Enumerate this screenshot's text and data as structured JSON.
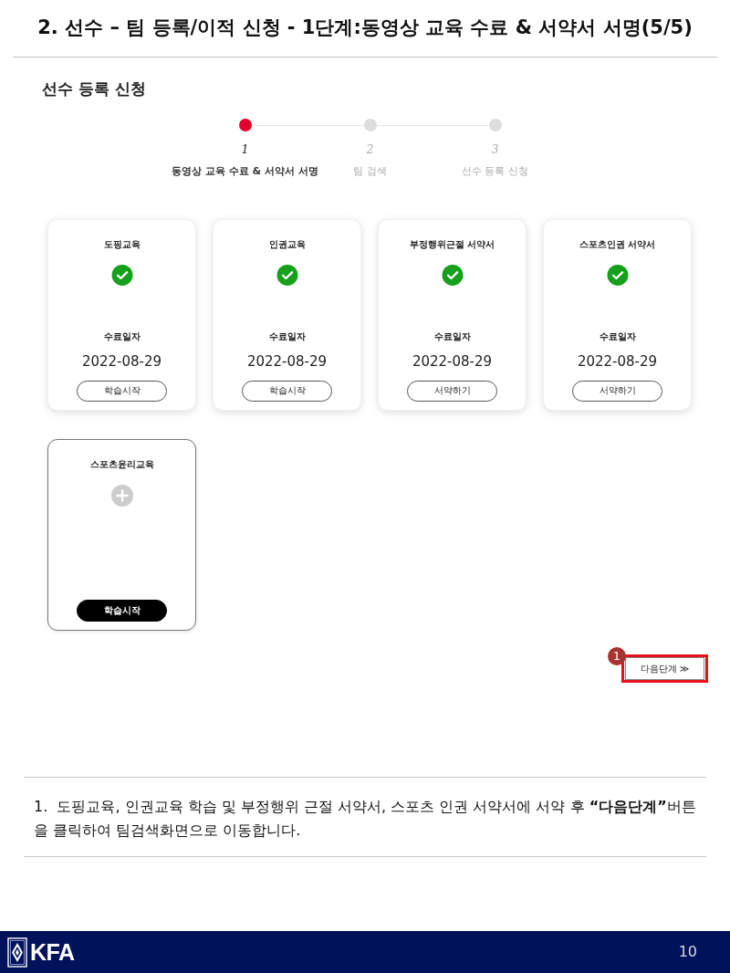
{
  "title": "2. 선수 – 팀 등록/이적 신청 - 1단계:동영상 교육 수료 & 서약서 서명(5/5)",
  "section_title": "선수 등록 신청",
  "steps": [
    {
      "number": "1",
      "label": "동영상 교육 수료 & 서약서 서명",
      "selected": true
    },
    {
      "number": "2",
      "label": "팀 검색",
      "selected": false
    },
    {
      "number": "3",
      "label": "선수 등록 신청",
      "selected": false
    }
  ],
  "cards": [
    {
      "title": "도핑교육",
      "completed": true,
      "date_label": "수료일자",
      "date": "2022-08-29",
      "button": "학습시작"
    },
    {
      "title": "인권교육",
      "completed": true,
      "date_label": "수료일자",
      "date": "2022-08-29",
      "button": "학습시작"
    },
    {
      "title": "부정행위근절 서약서",
      "completed": true,
      "date_label": "수료일자",
      "date": "2022-08-29",
      "button": "서약하기"
    },
    {
      "title": "스포츠인권 서약서",
      "completed": true,
      "date_label": "수료일자",
      "date": "2022-08-29",
      "button": "서약하기"
    },
    {
      "title": "스포츠윤리교육",
      "completed": false,
      "button": "학습시작"
    }
  ],
  "next_button": {
    "label": "다음단계 ≫",
    "highlighted": true,
    "callout": "1"
  },
  "note": "1.  도핑교육, 인권교육 학습 및 부정행위 근절 서약서, 스포츠 인권 서약서에 서약 후 **“다음단계”**버튼을 클릭하여 팀검색화면으로 이동합니다.",
  "footer": {
    "logo_text": "KFA",
    "page_number": "10"
  }
}
